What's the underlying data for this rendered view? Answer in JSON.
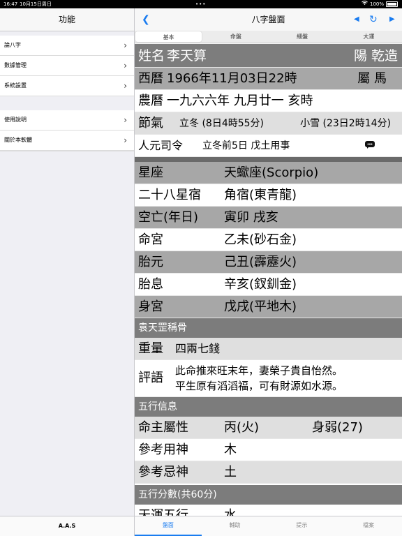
{
  "status": {
    "time": "16:47",
    "date": "10月15日周日",
    "battery": "100%"
  },
  "sidebar": {
    "title": "功能",
    "items": [
      "論八字",
      "數據管理",
      "系統設置"
    ],
    "items2": [
      "使用說明",
      "關於本軟體"
    ],
    "footer": "A.A.S"
  },
  "main": {
    "title": "八字盤面",
    "tabs": [
      "基本",
      "命盤",
      "細盤",
      "大運"
    ],
    "bottom_tabs": [
      "盤面",
      "輔助",
      "提示",
      "檔案"
    ]
  },
  "basic": {
    "name_label": "姓名",
    "name": "李天算",
    "gender": "陽 乾造",
    "western_label": "西曆",
    "western": "1966年11月03日22時",
    "zodiac": "屬 馬",
    "lunar_label": "農曆",
    "lunar": "一九六六年 九月廿一 亥時",
    "jieqi_label": "節氣",
    "jieqi1": "立冬 (8日4時55分)",
    "jieqi2": "小雪 (23日2時14分)",
    "renyuan_label": "人元司令",
    "renyuan": "立冬前5日 戊土用事"
  },
  "details": [
    {
      "label": "星座",
      "value": "天蠍座(Scorpio)"
    },
    {
      "label": "二十八星宿",
      "value": "角宿(東青龍)"
    },
    {
      "label": "空亡(年日)",
      "value": "寅卯 戌亥"
    },
    {
      "label": "命宮",
      "value": "乙未(砂石金)"
    },
    {
      "label": "胎元",
      "value": "己丑(霹靂火)"
    },
    {
      "label": "胎息",
      "value": "辛亥(釵釧金)"
    },
    {
      "label": "身宮",
      "value": "戊戌(平地木)"
    }
  ],
  "bone": {
    "header": "袁天罡稱骨",
    "weight_label": "重量",
    "weight": "四兩七錢",
    "comment_label": "評語",
    "comment_line1": "此命推來旺末年，妻榮子貴自怡然。",
    "comment_line2": "平生原有滔滔福，可有財源如水源。"
  },
  "wuxing": {
    "header": "五行信息",
    "rows": [
      {
        "label": "命主屬性",
        "value": "丙(火)",
        "extra": "身弱(27)"
      },
      {
        "label": "參考用神",
        "value": "木",
        "extra": ""
      },
      {
        "label": "參考忌神",
        "value": "土",
        "extra": ""
      }
    ],
    "score_header": "五行分數(共60分)",
    "partial_label": "天運五行",
    "partial_value": "水"
  }
}
